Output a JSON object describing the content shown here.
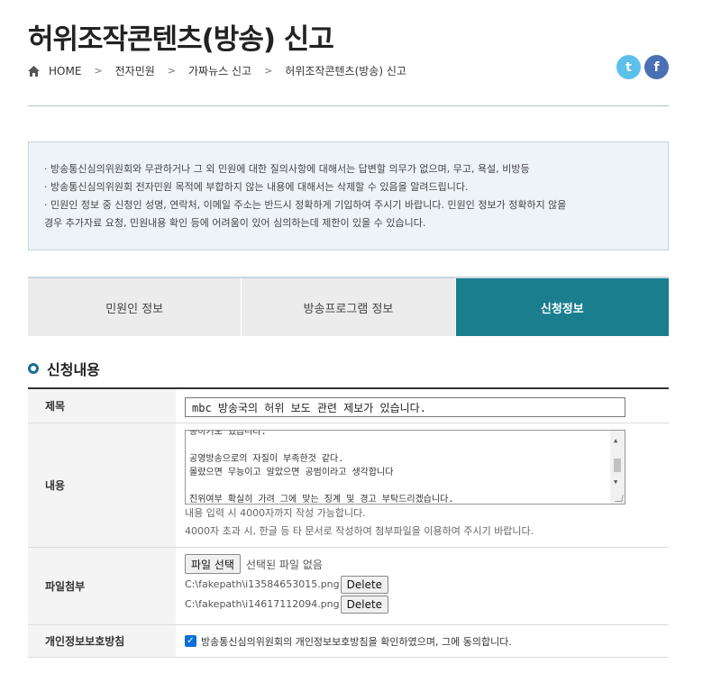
{
  "page": {
    "title": "허위조작콘텐츠(방송) 신고"
  },
  "breadcrumb": {
    "home": "HOME",
    "separator": ">",
    "items": [
      "전자민원",
      "가짜뉴스 신고",
      "허위조작콘텐츠(방송) 신고"
    ]
  },
  "social": {
    "twitter": "t",
    "facebook": "f"
  },
  "notice": {
    "lines": [
      "· 방송통신심의위원회와 무관하거나 그 외 민원에 대한 질의사항에 대해서는 답변할 의무가 없으며, 무고, 욕설, 비방등",
      "· 방송통신심의위원회 전자민원 목적에 부합하지 않는 내용에 대해서는 삭제할 수 있음을 알려드립니다.",
      "· 민원인 정보 중 신청인 성명, 연락처, 이메일 주소는 반드시 정확하게 기입하여 주시기 바랍니다. 민원인 정보가 정확하지 않을",
      "경우 추가자료 요청, 민원내용 확인 등에 어려움이 있어 심의하는데 제한이 있을 수 있습니다."
    ]
  },
  "tabs": [
    {
      "label": "민원인 정보"
    },
    {
      "label": "방송프로그램 정보"
    },
    {
      "label": "신청정보"
    }
  ],
  "section": {
    "title": "신청내용"
  },
  "form": {
    "title": {
      "label": "제목",
      "value": "mbc 방송국의 허위 보도 관련 제보가 있습니다."
    },
    "content": {
      "label": "내용",
      "lines": [
        "통하기도 했습니다.",
        "",
        "공영방송으로의 자질이 부족한것 같다.",
        "몰랐으면 무능이고 알았으면 공범이라고 생각합니다",
        "",
        "진위여부 확실히 가려 그에 맞는 징계 및 경고 부탁드리겠습니다."
      ],
      "hint1": "내용 입력 시 4000자까지 작성 가능합니다.",
      "hint2": "4000자 초과 시, 한글 등 타 문서로 작성하여 첨부파일을 이용하여 주시기 바랍니다."
    },
    "file": {
      "label": "파일첨부",
      "choose_label": "파일 선택",
      "none_text": "선택된 파일 없음",
      "attachments": [
        {
          "path": "C:\\fakepath\\i13584653015.png",
          "delete_label": "Delete"
        },
        {
          "path": "C:\\fakepath\\i14617112094.png",
          "delete_label": "Delete"
        }
      ]
    },
    "privacy": {
      "label": "개인정보보호방침",
      "checked": true,
      "text": "방송통신심의위원회의 개인정보보호방침을 확인하였으며, 그에 동의합니다."
    }
  }
}
